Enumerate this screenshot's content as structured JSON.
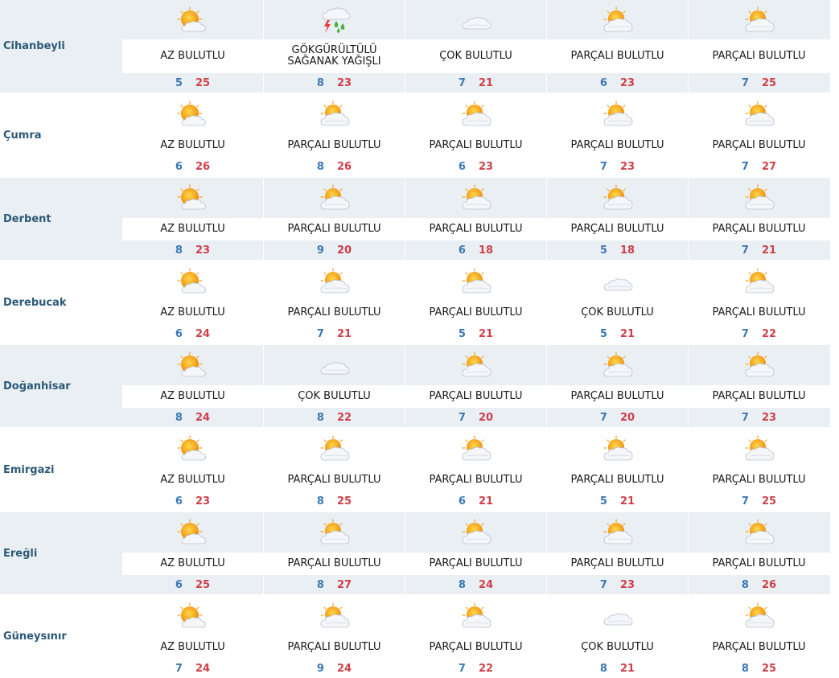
{
  "days": 5,
  "colors": {
    "band": "#e9eff3",
    "white": "#ffffff",
    "min": "#3b78b5",
    "max": "#d0404a",
    "city": "#2c5a78"
  },
  "rows": [
    {
      "city": "Cihanbeyli",
      "style": "large",
      "cells": [
        {
          "icon": "sun-cloud-icon",
          "desc": "AZ BULUTLU",
          "min": "5",
          "max": "25"
        },
        {
          "icon": "thunder-rain-icon",
          "desc": "GÖKGÜRÜLTÜLÜ SAĞANAK YAĞIŞLI",
          "min": "8",
          "max": "23"
        },
        {
          "icon": "cloud-icon",
          "desc": "ÇOK BULUTLU",
          "min": "7",
          "max": "21"
        },
        {
          "icon": "partly-cloudy-icon",
          "desc": "PARÇALI BULUTLU",
          "min": "6",
          "max": "23"
        },
        {
          "icon": "partly-cloudy-icon",
          "desc": "PARÇALI BULUTLU",
          "min": "7",
          "max": "25"
        }
      ]
    },
    {
      "city": "Çumra",
      "style": "plain",
      "cells": [
        {
          "icon": "sun-cloud-icon",
          "desc": "AZ BULUTLU",
          "min": "6",
          "max": "26"
        },
        {
          "icon": "partly-cloudy-icon",
          "desc": "PARÇALI BULUTLU",
          "min": "8",
          "max": "26"
        },
        {
          "icon": "partly-cloudy-icon",
          "desc": "PARÇALI BULUTLU",
          "min": "6",
          "max": "23"
        },
        {
          "icon": "partly-cloudy-icon",
          "desc": "PARÇALI BULUTLU",
          "min": "7",
          "max": "23"
        },
        {
          "icon": "partly-cloudy-icon",
          "desc": "PARÇALI BULUTLU",
          "min": "7",
          "max": "27"
        }
      ]
    },
    {
      "city": "Derbent",
      "style": "banded",
      "cells": [
        {
          "icon": "sun-cloud-icon",
          "desc": "AZ BULUTLU",
          "min": "8",
          "max": "23"
        },
        {
          "icon": "partly-cloudy-icon",
          "desc": "PARÇALI BULUTLU",
          "min": "9",
          "max": "20"
        },
        {
          "icon": "partly-cloudy-icon",
          "desc": "PARÇALI BULUTLU",
          "min": "6",
          "max": "18"
        },
        {
          "icon": "partly-cloudy-icon",
          "desc": "PARÇALI BULUTLU",
          "min": "5",
          "max": "18"
        },
        {
          "icon": "partly-cloudy-icon",
          "desc": "PARÇALI BULUTLU",
          "min": "7",
          "max": "21"
        }
      ]
    },
    {
      "city": "Derebucak",
      "style": "plain",
      "cells": [
        {
          "icon": "sun-cloud-icon",
          "desc": "AZ BULUTLU",
          "min": "6",
          "max": "24"
        },
        {
          "icon": "partly-cloudy-icon",
          "desc": "PARÇALI BULUTLU",
          "min": "7",
          "max": "21"
        },
        {
          "icon": "partly-cloudy-icon",
          "desc": "PARÇALI BULUTLU",
          "min": "5",
          "max": "21"
        },
        {
          "icon": "cloud-icon",
          "desc": "ÇOK BULUTLU",
          "min": "5",
          "max": "21"
        },
        {
          "icon": "partly-cloudy-icon",
          "desc": "PARÇALI BULUTLU",
          "min": "7",
          "max": "22"
        }
      ]
    },
    {
      "city": "Doğanhisar",
      "style": "banded",
      "cells": [
        {
          "icon": "sun-cloud-icon",
          "desc": "AZ BULUTLU",
          "min": "8",
          "max": "24"
        },
        {
          "icon": "cloud-icon",
          "desc": "ÇOK BULUTLU",
          "min": "8",
          "max": "22"
        },
        {
          "icon": "partly-cloudy-icon",
          "desc": "PARÇALI BULUTLU",
          "min": "7",
          "max": "20"
        },
        {
          "icon": "partly-cloudy-icon",
          "desc": "PARÇALI BULUTLU",
          "min": "7",
          "max": "20"
        },
        {
          "icon": "partly-cloudy-icon",
          "desc": "PARÇALI BULUTLU",
          "min": "7",
          "max": "23"
        }
      ]
    },
    {
      "city": "Emirgazi",
      "style": "plain",
      "cells": [
        {
          "icon": "sun-cloud-icon",
          "desc": "AZ BULUTLU",
          "min": "6",
          "max": "23"
        },
        {
          "icon": "partly-cloudy-icon",
          "desc": "PARÇALI BULUTLU",
          "min": "8",
          "max": "25"
        },
        {
          "icon": "partly-cloudy-icon",
          "desc": "PARÇALI BULUTLU",
          "min": "6",
          "max": "21"
        },
        {
          "icon": "partly-cloudy-icon",
          "desc": "PARÇALI BULUTLU",
          "min": "5",
          "max": "21"
        },
        {
          "icon": "partly-cloudy-icon",
          "desc": "PARÇALI BULUTLU",
          "min": "7",
          "max": "25"
        }
      ]
    },
    {
      "city": "Ereğli",
      "style": "banded",
      "cells": [
        {
          "icon": "sun-cloud-icon",
          "desc": "AZ BULUTLU",
          "min": "6",
          "max": "25"
        },
        {
          "icon": "partly-cloudy-icon",
          "desc": "PARÇALI BULUTLU",
          "min": "8",
          "max": "27"
        },
        {
          "icon": "partly-cloudy-icon",
          "desc": "PARÇALI BULUTLU",
          "min": "8",
          "max": "24"
        },
        {
          "icon": "partly-cloudy-icon",
          "desc": "PARÇALI BULUTLU",
          "min": "7",
          "max": "23"
        },
        {
          "icon": "partly-cloudy-icon",
          "desc": "PARÇALI BULUTLU",
          "min": "8",
          "max": "26"
        }
      ]
    },
    {
      "city": "Güneysınır",
      "style": "plain",
      "cells": [
        {
          "icon": "sun-cloud-icon",
          "desc": "AZ BULUTLU",
          "min": "7",
          "max": "24"
        },
        {
          "icon": "partly-cloudy-icon",
          "desc": "PARÇALI BULUTLU",
          "min": "9",
          "max": "24"
        },
        {
          "icon": "partly-cloudy-icon",
          "desc": "PARÇALI BULUTLU",
          "min": "7",
          "max": "22"
        },
        {
          "icon": "cloud-icon",
          "desc": "ÇOK BULUTLU",
          "min": "8",
          "max": "21"
        },
        {
          "icon": "partly-cloudy-icon",
          "desc": "PARÇALI BULUTLU",
          "min": "8",
          "max": "25"
        }
      ]
    }
  ]
}
